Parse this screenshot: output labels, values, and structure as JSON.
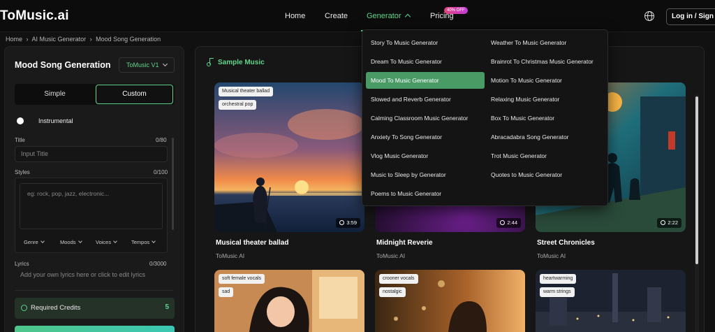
{
  "brand": {
    "logo": "ToMusic.ai",
    "accent": "#5fd68b"
  },
  "nav": {
    "home": "Home",
    "create": "Create",
    "generator": "Generator",
    "pricing": "Pricing",
    "pricing_badge": "40% OFF",
    "login": "Log in / Sign Up"
  },
  "breadcrumb": [
    "Home",
    "AI Music Generator",
    "Mood Song Generation"
  ],
  "breadcrumb_sep": "›",
  "form": {
    "title": "Mood Song Generation",
    "version": "ToMusic V1",
    "mode_simple": "Simple",
    "mode_custom": "Custom",
    "instrumental": "Instrumental",
    "title_label": "Title",
    "title_count": "0/80",
    "title_placeholder": "Input Title",
    "styles_label": "Styles",
    "styles_count": "0/100",
    "styles_placeholder": "eg: rock, pop, jazz, electronic...",
    "style_chips": [
      "Genre",
      "Moods",
      "Voices",
      "Tempos"
    ],
    "lyrics_label": "Lyrics",
    "lyrics_count": "0/3000",
    "lyrics_placeholder": "Add your own lyrics here or click to edit lyrics",
    "credits_label": "Required Credits",
    "credits_value": "5"
  },
  "samples": {
    "header": "Sample Music",
    "cards": [
      {
        "title": "Musical theater ballad",
        "author": "ToMusic AI",
        "duration": "3:59",
        "tags": [
          "Musical theater ballad",
          "orchestral pop"
        ]
      },
      {
        "title": "Midnight Reverie",
        "author": "ToMusic AI",
        "duration": "2:44",
        "tags": []
      },
      {
        "title": "Street Chronicles",
        "author": "ToMusic AI",
        "duration": "2:22",
        "tags": []
      },
      {
        "title": "",
        "author": "",
        "duration": "",
        "tags": [
          "soft female vocals",
          "sad"
        ]
      },
      {
        "title": "",
        "author": "",
        "duration": "",
        "tags": [
          "crooner vocals",
          "nostalgic"
        ]
      },
      {
        "title": "",
        "author": "",
        "duration": "",
        "tags": [
          "heartwarming",
          "warm strings"
        ]
      }
    ]
  },
  "generator_menu": {
    "left": [
      "Story To Music Generator",
      "Dream To Music Generator",
      "Mood To Music Generator",
      "Slowed and Reverb Generator",
      "Calming Classroom Music Generator",
      "Anxiety To Song Generator",
      "Vlog Music Generator",
      "Music to Sleep by Generator",
      "Poems to Music Generator"
    ],
    "right": [
      "Weather To Music Generator",
      "Brainrot To Christmas Music Generator",
      "Motion To Music Generator",
      "Relaxing Music Generator",
      "Box To Music Generator",
      "Abracadabra Song Generator",
      "Trot Music Generator",
      "Quotes to Music Generator"
    ],
    "active": "Mood To Music Generator"
  }
}
